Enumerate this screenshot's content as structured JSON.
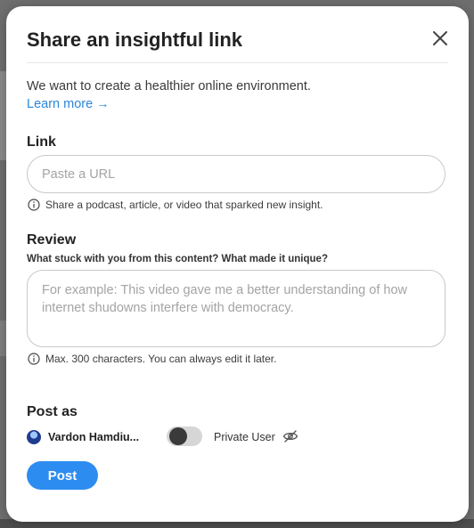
{
  "modal": {
    "title": "Share an insightful link",
    "intro": "We want to create a healthier online environment.",
    "learn_more": "Learn more →"
  },
  "link": {
    "label": "Link",
    "placeholder": "Paste a URL",
    "value": "",
    "hint": "Share a podcast, article, or video that sparked new insight."
  },
  "review": {
    "label": "Review",
    "question": "What stuck with you from this content? What made it unique?",
    "placeholder": "For example: This video gave me a better understanding of how internet shudowns interfere with democracy.",
    "value": "",
    "hint": "Max. 300 characters. You can always edit it later."
  },
  "post_as": {
    "label": "Post as",
    "user_name": "Vardon Hamdiu...",
    "private_toggle_on": false,
    "private_label": "Private User"
  },
  "actions": {
    "post_label": "Post"
  },
  "colors": {
    "accent": "#2d8cf0",
    "link": "#2d86d8"
  }
}
